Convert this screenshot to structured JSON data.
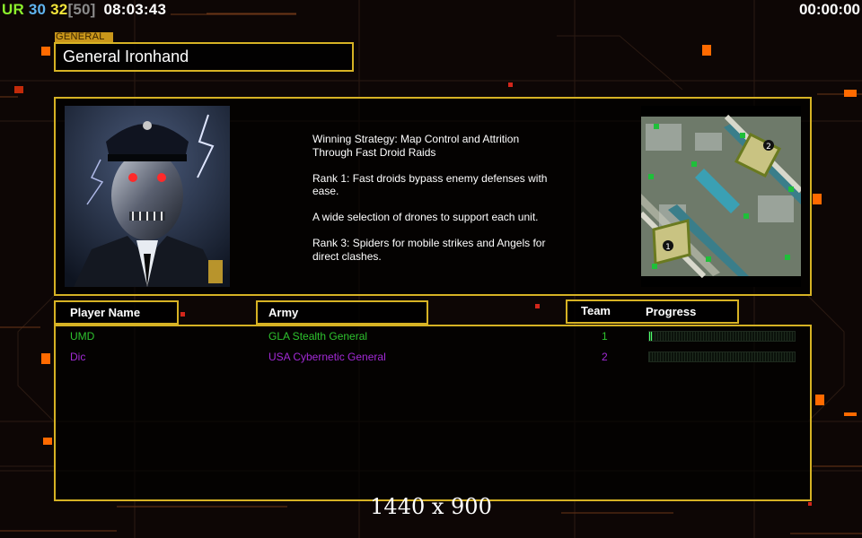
{
  "topbar": {
    "ur_label": "UR",
    "stat_a": "30",
    "stat_b": "32",
    "stat_c": "[50]",
    "clock": "08:03:43",
    "game_timer": "00:00:00"
  },
  "general": {
    "tag": "GENERAL",
    "name": "General Ironhand"
  },
  "strategy": [
    "Winning Strategy: Map Control and Attrition\n Through Fast Droid Raids",
    "Rank 1: Fast droids bypass enemy defenses with\n ease.",
    "A wide selection of drones to support each unit.",
    "Rank 3: Spiders for mobile strikes and Angels for\n direct clashes."
  ],
  "minimap": {
    "start_positions": [
      "1",
      "2"
    ]
  },
  "columns": {
    "player_name": "Player Name",
    "army": "Army",
    "team": "Team",
    "progress": "Progress"
  },
  "players": [
    {
      "name": "UMD",
      "army": "GLA Stealth General",
      "team": "1",
      "progress": 0.02,
      "color": "#2ec32e"
    },
    {
      "name": "Dic",
      "army": "USA Cybernetic General",
      "team": "2",
      "progress": 0.0,
      "color": "#a32ad6"
    }
  ],
  "resolution": "1440 x 900",
  "colors": {
    "frame": "#d6b224",
    "accent_orange": "#ff6a00",
    "background": "#0d0605"
  }
}
